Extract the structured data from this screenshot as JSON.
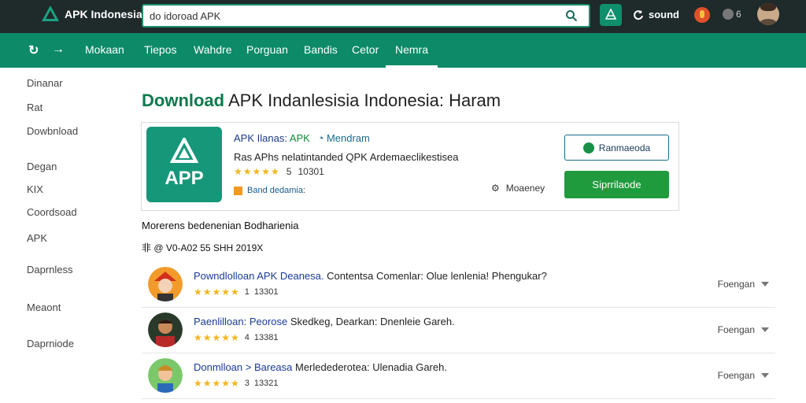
{
  "header": {
    "logo_text": "APK Indonesia",
    "search_value": "do idoroad APK",
    "sound_label": "sound",
    "count_label": "6"
  },
  "nav": {
    "items": [
      "Mokaan",
      "Tiepos",
      "Wahdre",
      "Porguan",
      "Bandis",
      "Cetor",
      "Nemra"
    ],
    "active_index": 6
  },
  "sidebar": {
    "items": [
      "Dinanar",
      "Rat",
      "Dowbnload",
      "Degan",
      "KIX",
      "Coordsoad",
      "APK",
      "Daprnless",
      "Meaont",
      "Daprniode"
    ]
  },
  "page": {
    "title_accent": "Download",
    "title_rest": " APK Indanlesisia Indonesia: Haram"
  },
  "featured": {
    "icon_text": "APP",
    "name": "APK Ilanas:",
    "mod": "APK",
    "note": "Mendram",
    "description": "Ras APhs nelatintanded QPK Ardemaeclikestisea",
    "stars": "★★★★★",
    "rating_count": "5",
    "rating_size": "10301",
    "tag": "Band dedamia:",
    "meta": "Moaeney",
    "btn_secondary": "Ranmaeoda",
    "btn_primary": "Siprrilaode"
  },
  "section": {
    "title": "Morerens bedenenian Bodharienia",
    "info": "非 @ V0-A02 55 SHH 2019X"
  },
  "rows": [
    {
      "title_link": "Powndlolloan APK Deanesa.",
      "title_rest": " Contentsa Comenlar: Olue lenlenia! Phengukar?",
      "stars": "★★★★★",
      "rating": "1",
      "size": "13301",
      "filter": "Foengan"
    },
    {
      "title_link": "Paenlilloan: Peorose",
      "title_rest": " Skedkeg, Dearkan: Dnenleie Gareh.",
      "stars": "★★★★★",
      "rating": "4",
      "size": "13381",
      "filter": "Foengan"
    },
    {
      "title_link": "Donmlloan > Bareasa",
      "title_rest": " Merledederotea: Ulenadia Gareh.",
      "stars": "★★★★★",
      "rating": "3",
      "size": "13321",
      "filter": "Foengan"
    }
  ],
  "colors": {
    "topbar": "#1f2a2a",
    "navbar": "#0d8a68",
    "accent_green": "#0d7a4e",
    "primary_button": "#1f9a3c",
    "star": "#f2b61c"
  }
}
